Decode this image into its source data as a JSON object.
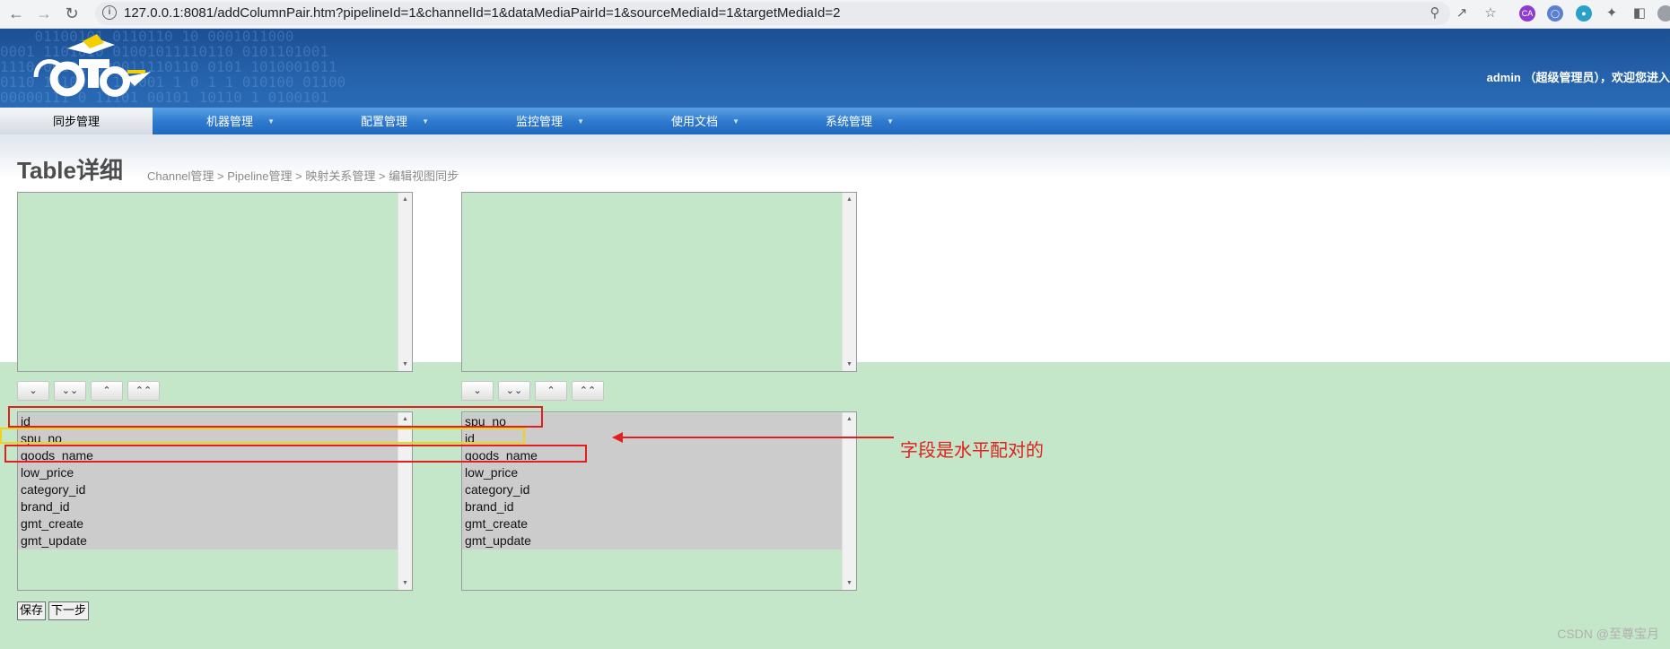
{
  "browser": {
    "url": "127.0.0.1:8081/addColumnPair.htm?pipelineId=1&channelId=1&dataMediaPairId=1&sourceMediaId=1&targetMediaId=2",
    "ext_ca_label": "CA"
  },
  "header": {
    "user_info": "admin （超级管理员），欢迎您进入"
  },
  "menu": {
    "items": [
      {
        "label": "同步管理"
      },
      {
        "label": "机器管理"
      },
      {
        "label": "配置管理"
      },
      {
        "label": "监控管理"
      },
      {
        "label": "使用文档"
      },
      {
        "label": "系统管理"
      }
    ]
  },
  "page": {
    "title": "Table详细",
    "breadcrumb": "Channel管理  >  Pipeline管理  >  映射关系管理  >  编辑视图同步"
  },
  "source_columns": [
    "id",
    "spu_no",
    "goods_name",
    "low_price",
    "category_id",
    "brand_id",
    "gmt_create",
    "gmt_update"
  ],
  "target_columns": [
    "spu_no",
    "id",
    "goods_name",
    "low_price",
    "category_id",
    "brand_id",
    "gmt_create",
    "gmt_update"
  ],
  "annotation": "字段是水平配对的",
  "actions": {
    "save": "保存",
    "next": "下一步"
  },
  "watermark": "CSDN @至尊宝月"
}
